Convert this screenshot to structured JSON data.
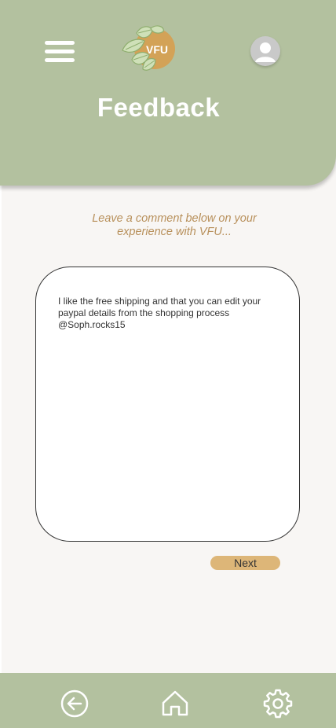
{
  "header": {
    "title": "Feedback",
    "logo_text": "VFU",
    "menu_icon": "hamburger-menu-icon",
    "profile_icon": "user-avatar-icon"
  },
  "feedback": {
    "prompt": "Leave a comment below on your experience with VFU...",
    "comment_value": "I like the free shipping and that you can edit your paypal details from the shopping process\n@Soph.rocks15",
    "next_label": "Next"
  },
  "bottom_nav": {
    "back_icon": "back-arrow-icon",
    "home_icon": "home-icon",
    "settings_icon": "gear-icon"
  },
  "colors": {
    "sage_green": "#b3c19f",
    "gold": "#ddb678",
    "logo_gold": "#d3a257",
    "prompt_text": "#b8905b",
    "background": "#f8f6f4"
  }
}
